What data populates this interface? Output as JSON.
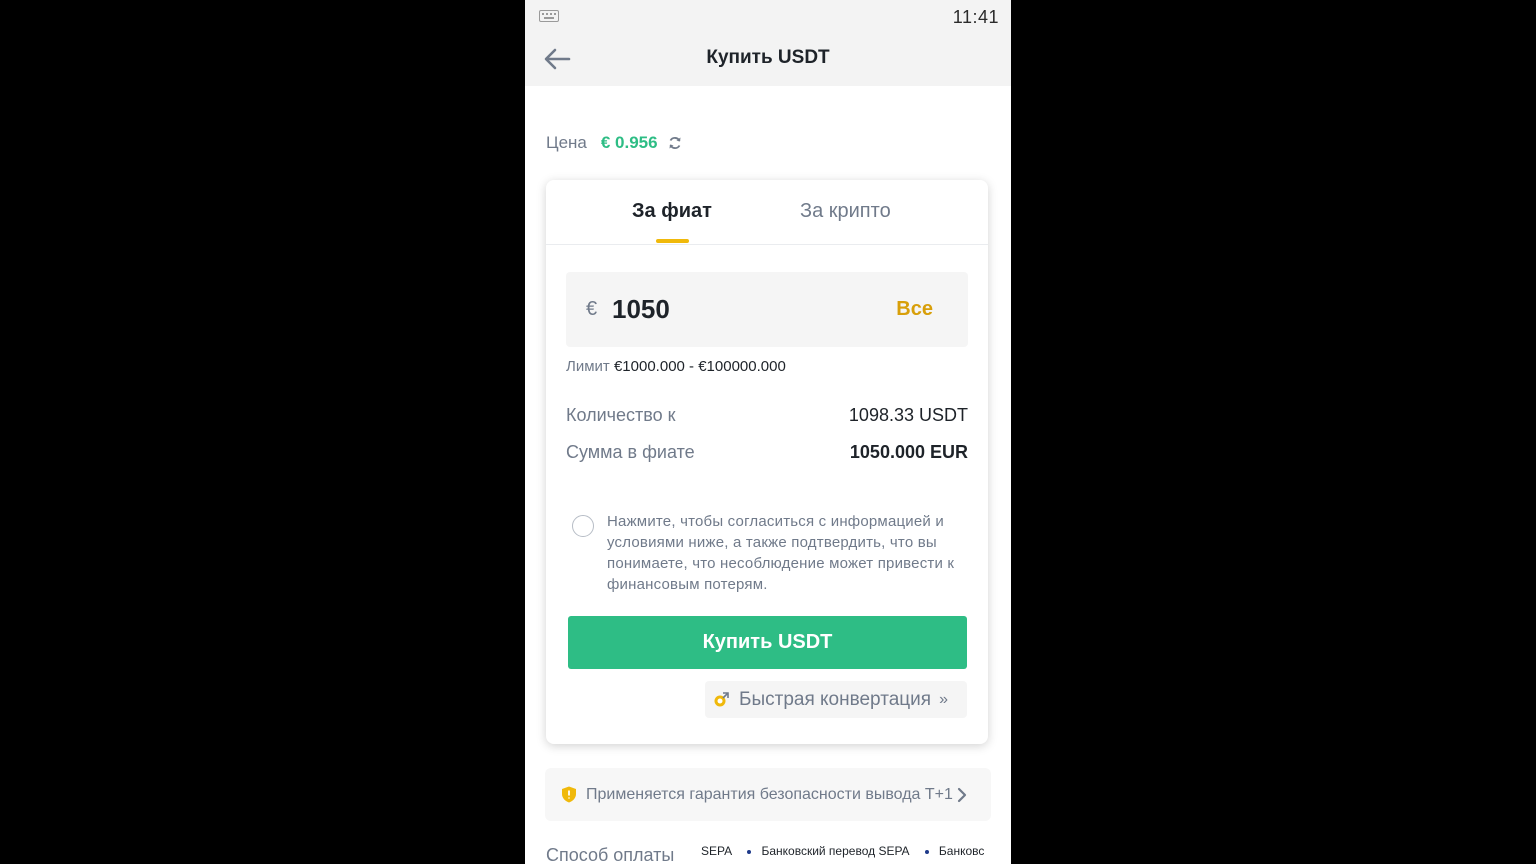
{
  "status_bar": {
    "time": "11:41"
  },
  "header": {
    "title": "Купить USDT"
  },
  "price": {
    "label": "Цена",
    "value": "€ 0.956"
  },
  "tabs": [
    {
      "label": "За фиат",
      "active": true
    },
    {
      "label": "За крипто",
      "active": false
    }
  ],
  "amount": {
    "currency_symbol": "€",
    "value": "1050",
    "all_label": "Все"
  },
  "limit": {
    "label": "Лимит",
    "value": "€1000.000 - €100000.000"
  },
  "summary": {
    "quantity_label": "Количество к",
    "quantity_value": "1098.33 USDT",
    "fiat_sum_label": "Сумма в фиате",
    "fiat_sum_value": "1050.000 EUR"
  },
  "agreement": {
    "checked": false,
    "text": "Нажмите, чтобы согласиться с информацией и условиями ниже, а также подтвердить, что вы понимаете, что несоблюдение может привести к финансовым потерям."
  },
  "buy_button": {
    "label": "Купить USDT"
  },
  "quick_convert": {
    "label": "Быстрая конвертация",
    "chevrons": "»"
  },
  "guarantee": {
    "text": "Применяется гарантия безопасности вывода T+1"
  },
  "payment": {
    "label": "Способ оплаты",
    "methods": [
      "SEPA",
      "Банковский перевод SEPA",
      "Банковс"
    ]
  },
  "colors": {
    "accent_green": "#2ebd85",
    "accent_yellow": "#f0b90b",
    "text_primary": "#1e2329",
    "text_secondary": "#707a8a"
  },
  "icons": [
    "keyboard-icon",
    "back-arrow-icon",
    "refresh-icon",
    "convert-icon",
    "shield-icon",
    "chevron-right-icon"
  ]
}
